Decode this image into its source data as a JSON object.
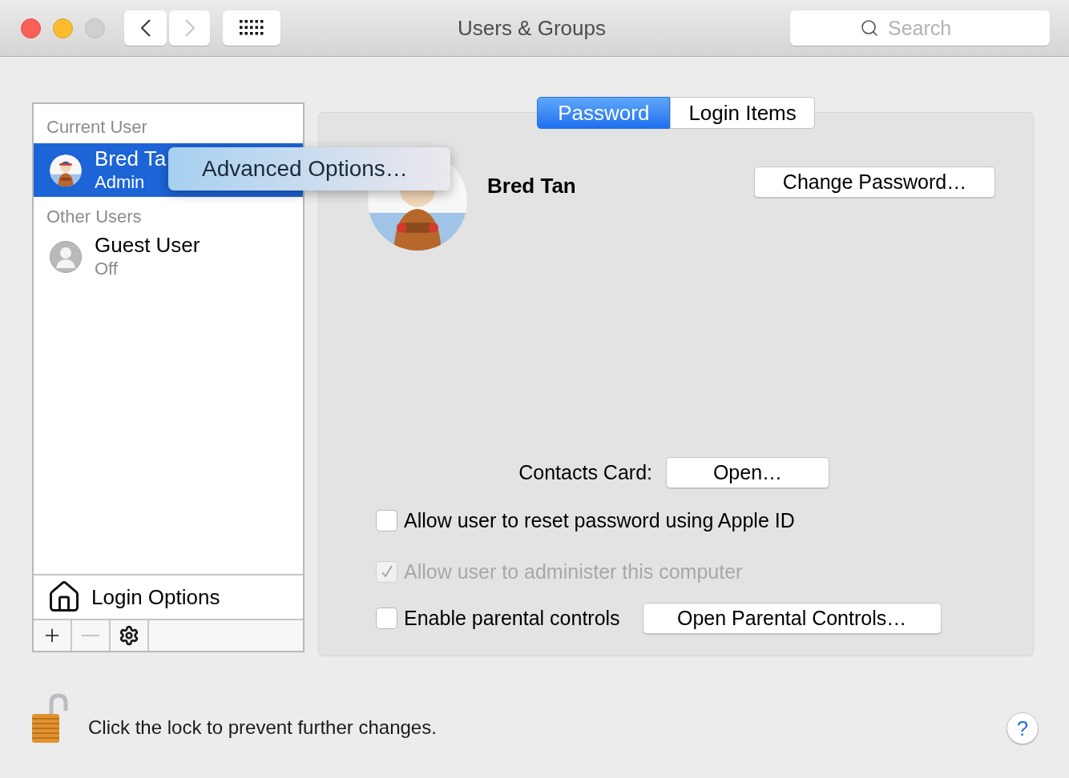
{
  "window": {
    "title": "Users & Groups",
    "search": {
      "placeholder": "Search"
    }
  },
  "sidebar": {
    "sections": [
      {
        "header": "Current User",
        "users": [
          {
            "name": "Bred Ta",
            "role": "Admin",
            "selected": true,
            "kind": "picture"
          }
        ]
      },
      {
        "header": "Other Users",
        "users": [
          {
            "name": "Guest User",
            "role": "Off",
            "selected": false,
            "kind": "silhouette"
          }
        ]
      }
    ],
    "login_options": "Login Options",
    "toolbar": [
      {
        "kind": "add",
        "disabled": false
      },
      {
        "kind": "remove",
        "disabled": true
      },
      {
        "kind": "gear",
        "disabled": false
      }
    ]
  },
  "context_menu": {
    "items": [
      "Advanced Options…"
    ]
  },
  "tabs": [
    {
      "label": "Password",
      "selected": true
    },
    {
      "label": "Login Items",
      "selected": false
    }
  ],
  "account": {
    "name": "Bred Tan",
    "change_password": "Change Password…",
    "contacts_label": "Contacts Card:",
    "contacts_button": "Open…"
  },
  "options": [
    {
      "label": "Allow user to reset password using Apple ID",
      "checked": false,
      "disabled": false
    },
    {
      "label": "Allow user to administer this computer",
      "checked": true,
      "disabled": true
    },
    {
      "label": "Enable parental controls",
      "checked": false,
      "disabled": false,
      "button": "Open Parental Controls…"
    }
  ],
  "footer": {
    "lock_text": "Click the lock to prevent further changes.",
    "help": "?"
  }
}
